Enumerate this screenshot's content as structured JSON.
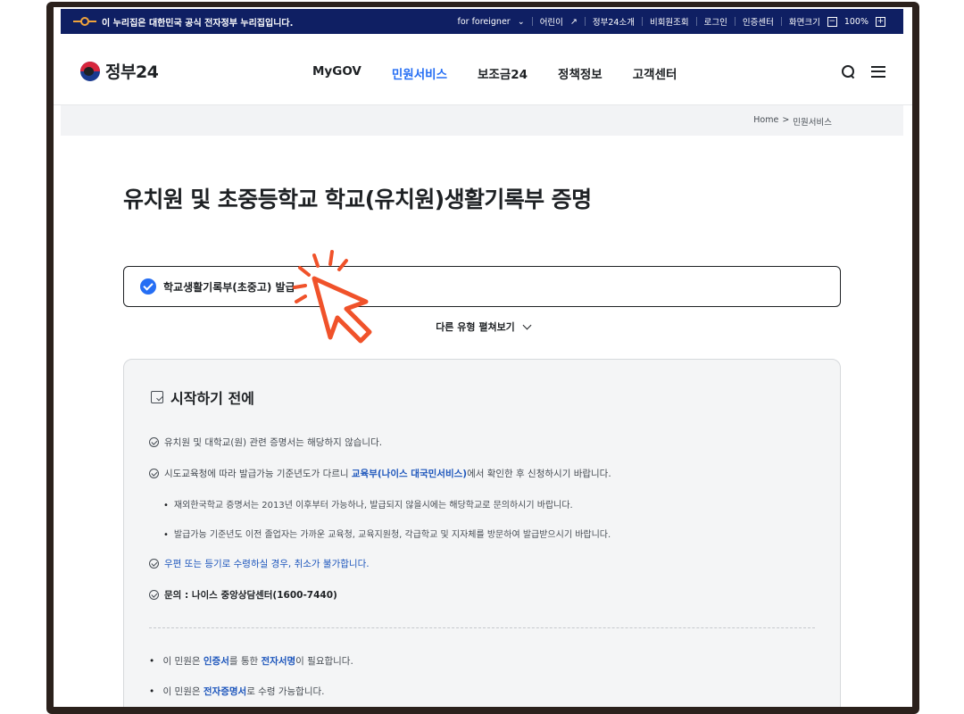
{
  "gov_banner": {
    "notice": "이 누리집은 대한민국 공식 전자정부 누리집입니다.",
    "links": [
      "for foreigner",
      "어린이",
      "정부24소개",
      "비회원조회",
      "로그인",
      "인증센터"
    ],
    "font_size_label": "화면크기",
    "zoom_minus": "−",
    "zoom_value": "100%",
    "zoom_plus": "+"
  },
  "header": {
    "logo_text": "정부24",
    "nav": [
      "MyGOV",
      "민원서비스",
      "보조금24",
      "정책정보",
      "고객센터"
    ],
    "active_nav": "민원서비스"
  },
  "breadcrumb": {
    "home": "Home",
    "sep": ">",
    "current": "민원서비스"
  },
  "page_title": "유치원 및 초중등학교 학교(유치원)생활기록부 증명",
  "selected_type": "학교생활기록부(초중고) 발급",
  "more_types_label": "다른 유형 펼쳐보기",
  "info": {
    "heading": "시작하기 전에",
    "item1": "유치원 및 대학교(원) 관련 증명서는 해당하지 않습니다.",
    "item2_pre": "시도교육청에 따라 발급가능 기준년도가 다르니 ",
    "item2_link": "교육부(나이스 대국민서비스)",
    "item2_post": "에서 확인한 후 신청하시기 바랍니다.",
    "sub1": "재외한국학교 증명서는 2013년 이후부터 가능하나, 발급되지 않을시에는 해당학교로 문의하시기 바랍니다.",
    "sub2": "발급가능 기준년도 이전 졸업자는 가까운 교육청, 교육지원청, 각급학교 및 지자체를 방문하여 발급받으시기 바랍니다.",
    "item3": "우편 또는 등기로 수령하실 경우, 취소가 불가합니다.",
    "item4": "문의 : 나이스 중앙상담센터(1600-7440)",
    "dot1_pre": "이 민원은 ",
    "dot1_b1": "인증서",
    "dot1_mid": "를 통한 ",
    "dot1_b2": "전자서명",
    "dot1_post": "이 필요합니다.",
    "dot2_pre": "이 민원은 ",
    "dot2_b": "전자증명서",
    "dot2_post": "로 수령 가능합니다."
  },
  "colors": {
    "primary": "#256ef4",
    "banner": "#0f1f63",
    "cursor": "#f0522a"
  }
}
